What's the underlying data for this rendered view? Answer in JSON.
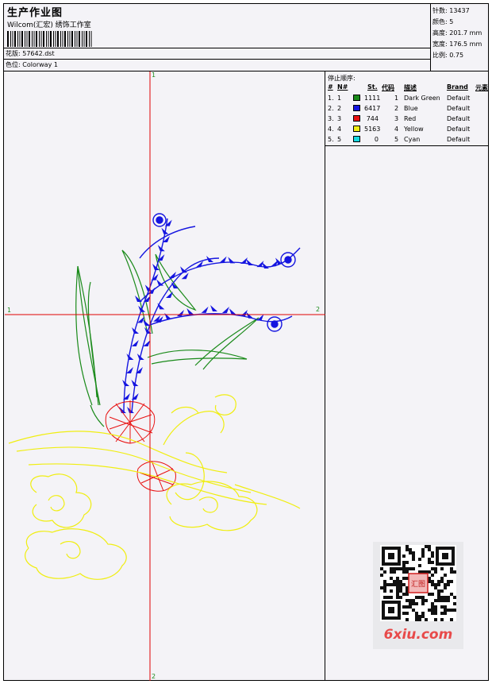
{
  "header": {
    "title": "生产作业图",
    "company": "Wilcom(汇宏) 绣饰工作室",
    "design_file": "花版: 57642.dst",
    "colorway": "色位: Colorway 1"
  },
  "stats": {
    "stitches": "针数: 13437",
    "colors": "颜色: 5",
    "height": "高度: 201.7 mm",
    "width": "宽度: 176.5 mm",
    "scale": "比例: 0.75"
  },
  "stop_sequence": {
    "label": "停止顺序:",
    "headers": [
      "#",
      "N#",
      "St.",
      "代码",
      "描述",
      "Brand",
      "元素"
    ],
    "rows": [
      {
        "idx": "1.",
        "n": "1",
        "stitches": "1111",
        "code": "1",
        "desc": "Dark Green",
        "brand": "Default",
        "color": "#1a8a1a"
      },
      {
        "idx": "2.",
        "n": "2",
        "stitches": "6417",
        "code": "2",
        "desc": "Blue",
        "brand": "Default",
        "color": "#1515e0"
      },
      {
        "idx": "3.",
        "n": "3",
        "stitches": "744",
        "code": "3",
        "desc": "Red",
        "brand": "Default",
        "color": "#e81010"
      },
      {
        "idx": "4.",
        "n": "4",
        "stitches": "5163",
        "code": "4",
        "desc": "Yellow",
        "brand": "Default",
        "color": "#f0ee10"
      },
      {
        "idx": "5.",
        "n": "5",
        "stitches": "0",
        "code": "5",
        "desc": "Cyan",
        "brand": "Default",
        "color": "#18d8e0"
      }
    ]
  },
  "axes": {
    "v_top": "1",
    "v_bottom": "2",
    "h_left": "1",
    "h_right": "2"
  },
  "watermark": {
    "site": "6xiu.com",
    "seal": "汇图"
  },
  "thread_colors": {
    "green": "#1a8a1a",
    "blue": "#1515e0",
    "red": "#e81010",
    "yellow": "#f0ee10",
    "axis": "#e00000"
  }
}
